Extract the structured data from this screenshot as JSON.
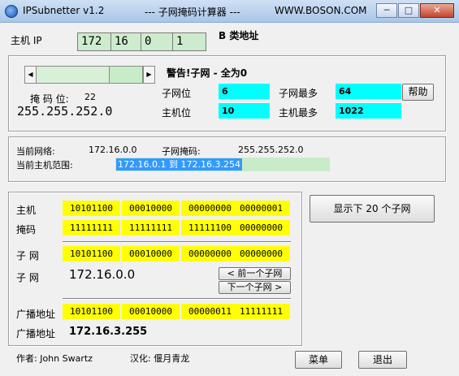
{
  "window": {
    "app_title": "IPSubnetter v1.2",
    "center_title": "--- 子网掩码计算器 ---",
    "site": "WWW.BOSON.COM",
    "minimize": "─",
    "maximize": "□",
    "close": "✕"
  },
  "ip": {
    "label": "主机 IP",
    "octets": [
      "172",
      "16",
      "0",
      "1"
    ],
    "class_label": "B 类地址"
  },
  "subnet_panel": {
    "warning": "警告!子网 - 全为0",
    "mask_bits_label": "掩 码 位:",
    "mask_bits_value": "22",
    "mask": "255.255.252.0",
    "subnet_bits_label": "子网位",
    "subnet_bits_value": "6",
    "max_subnets_label": "子网最多",
    "max_subnets_value": "64",
    "host_bits_label": "主机位",
    "host_bits_value": "10",
    "max_hosts_label": "主机最多",
    "max_hosts_value": "1022",
    "help_button": "帮助",
    "scroll_left": "◀",
    "scroll_right": "▶"
  },
  "current": {
    "network_label": "当前网络:",
    "network_value": "172.16.0.0",
    "subnet_mask_label": "子网掩码:",
    "subnet_mask_value": "255.255.252.0",
    "host_range_label": "当前主机范围:",
    "host_range_value": "172.16.0.1 到 172.16.3.254"
  },
  "binary": {
    "host_label": "主机",
    "host": [
      "10101100",
      "00010000",
      "00000000",
      "00000001"
    ],
    "mask_label": "掩码",
    "mask": [
      "11111111",
      "11111111",
      "11111100",
      "00000000"
    ],
    "subnet_label": "子 网",
    "subnet": [
      "10101100",
      "00010000",
      "00000000",
      "00000000"
    ],
    "subnet_addr_label": "子 网",
    "subnet_addr": "172.16.0.0",
    "prev_button": "< 前一个子网",
    "next_button": "下一个子网 >",
    "broadcast_label": "广播地址",
    "broadcast": [
      "10101100",
      "00010000",
      "00000011",
      "11111111"
    ],
    "broadcast_addr_label": "广播地址",
    "broadcast_addr": "172.16.3.255"
  },
  "show_subnets_button": "显示下 20 个子网",
  "footer": {
    "author": "作者: John Swartz",
    "localized": "汉化: 偃月青龙",
    "menu_button": "菜单",
    "exit_button": "退出"
  }
}
